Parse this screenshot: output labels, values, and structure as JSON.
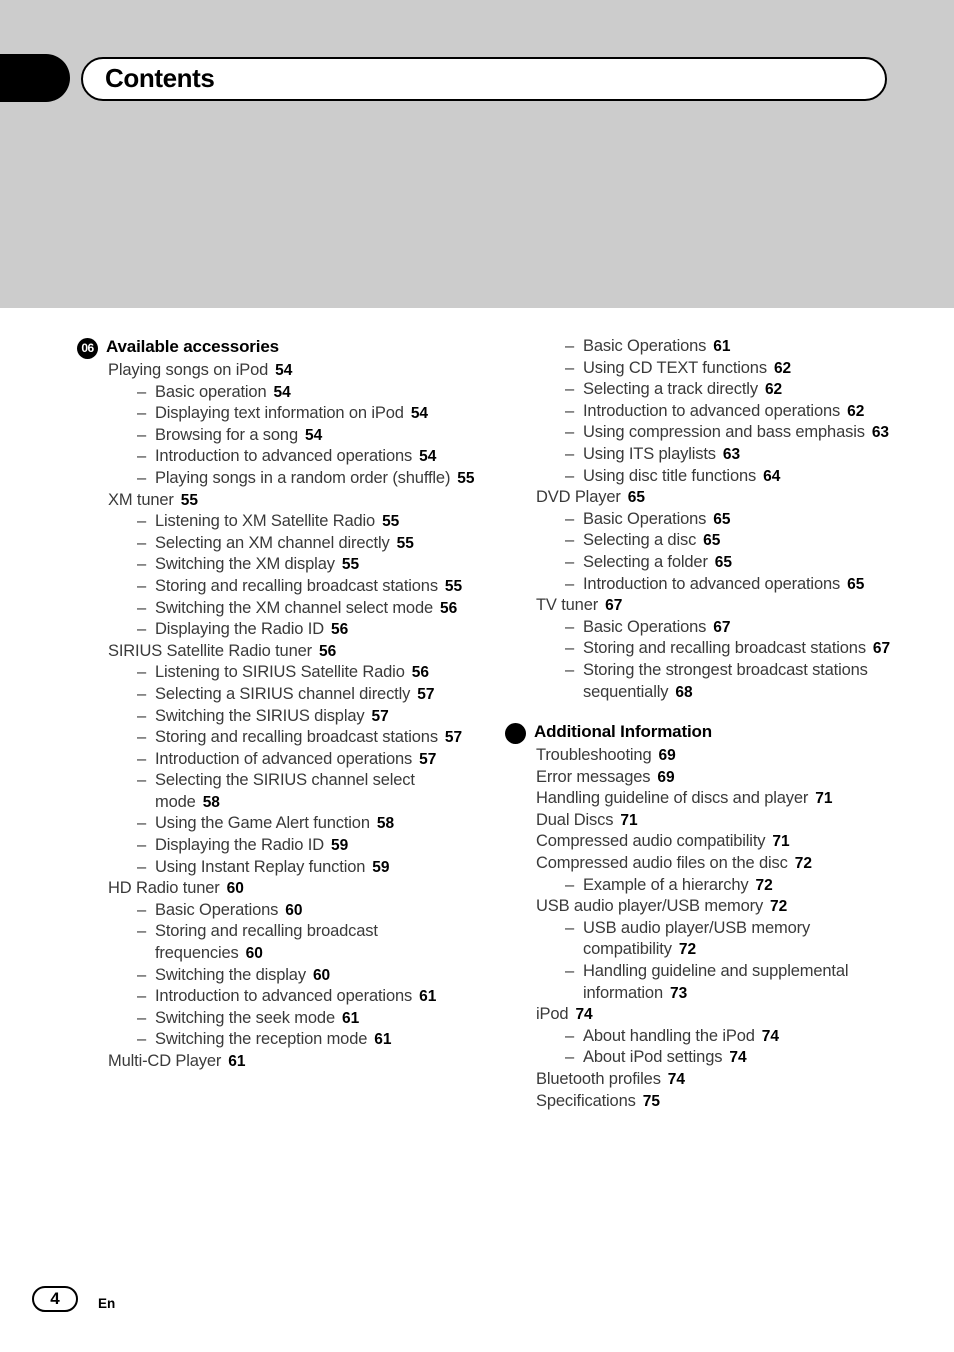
{
  "page": {
    "title": "Contents",
    "number": "4",
    "language": "En"
  },
  "columns": {
    "left": [
      {
        "badge": "06",
        "badge_type": "number",
        "heading": "Available accessories",
        "entries": [
          {
            "level": 1,
            "text": "Playing songs on iPod",
            "page": "54"
          },
          {
            "level": 2,
            "text": "Basic operation",
            "page": "54"
          },
          {
            "level": 2,
            "text": "Displaying text information on iPod",
            "page": "54"
          },
          {
            "level": 2,
            "text": "Browsing for a song",
            "page": "54"
          },
          {
            "level": 2,
            "text": "Introduction to advanced operations",
            "page": "54"
          },
          {
            "level": 2,
            "text": "Playing songs in a random order (shuffle)",
            "page": "55"
          },
          {
            "level": 1,
            "text": "XM tuner",
            "page": "55"
          },
          {
            "level": 2,
            "text": "Listening to XM Satellite Radio",
            "page": "55"
          },
          {
            "level": 2,
            "text": "Selecting an XM channel directly",
            "page": "55"
          },
          {
            "level": 2,
            "text": "Switching the XM display",
            "page": "55"
          },
          {
            "level": 2,
            "text": "Storing and recalling broadcast stations",
            "page": "55"
          },
          {
            "level": 2,
            "text": "Switching the XM channel select mode",
            "page": "56"
          },
          {
            "level": 2,
            "text": "Displaying the Radio ID",
            "page": "56"
          },
          {
            "level": 1,
            "text": "SIRIUS Satellite Radio tuner",
            "page": "56"
          },
          {
            "level": 2,
            "text": "Listening to SIRIUS Satellite Radio",
            "page": "56"
          },
          {
            "level": 2,
            "text": "Selecting a SIRIUS channel directly",
            "page": "57"
          },
          {
            "level": 2,
            "text": "Switching the SIRIUS display",
            "page": "57"
          },
          {
            "level": 2,
            "text": "Storing and recalling broadcast stations",
            "page": "57"
          },
          {
            "level": 2,
            "text": "Introduction of advanced operations",
            "page": "57"
          },
          {
            "level": 2,
            "text": "Selecting the SIRIUS channel select mode",
            "page": "58"
          },
          {
            "level": 2,
            "text": "Using the Game Alert function",
            "page": "58"
          },
          {
            "level": 2,
            "text": "Displaying the Radio ID",
            "page": "59"
          },
          {
            "level": 2,
            "text": "Using Instant Replay function",
            "page": "59"
          },
          {
            "level": 1,
            "text": "HD Radio tuner",
            "page": "60"
          },
          {
            "level": 2,
            "text": "Basic Operations",
            "page": "60"
          },
          {
            "level": 2,
            "text": "Storing and recalling broadcast frequencies",
            "page": "60"
          },
          {
            "level": 2,
            "text": "Switching the display",
            "page": "60"
          },
          {
            "level": 2,
            "text": "Introduction to advanced operations",
            "page": "61"
          },
          {
            "level": 2,
            "text": "Switching the seek mode",
            "page": "61"
          },
          {
            "level": 2,
            "text": "Switching the reception mode",
            "page": "61"
          },
          {
            "level": 1,
            "text": "Multi-CD Player",
            "page": "61"
          }
        ]
      }
    ],
    "right": [
      {
        "badge": null,
        "badge_type": "none",
        "heading": null,
        "entries": [
          {
            "level": 2,
            "text": "Basic Operations",
            "page": "61"
          },
          {
            "level": 2,
            "text": "Using CD TEXT functions",
            "page": "62"
          },
          {
            "level": 2,
            "text": "Selecting a track directly",
            "page": "62"
          },
          {
            "level": 2,
            "text": "Introduction to advanced operations",
            "page": "62"
          },
          {
            "level": 2,
            "text": "Using compression and bass emphasis",
            "page": "63"
          },
          {
            "level": 2,
            "text": "Using ITS playlists",
            "page": "63"
          },
          {
            "level": 2,
            "text": "Using disc title functions",
            "page": "64"
          },
          {
            "level": 1,
            "text": "DVD Player",
            "page": "65"
          },
          {
            "level": 2,
            "text": "Basic Operations",
            "page": "65"
          },
          {
            "level": 2,
            "text": "Selecting a disc",
            "page": "65"
          },
          {
            "level": 2,
            "text": "Selecting a folder",
            "page": "65"
          },
          {
            "level": 2,
            "text": "Introduction to advanced operations",
            "page": "65"
          },
          {
            "level": 1,
            "text": "TV tuner",
            "page": "67"
          },
          {
            "level": 2,
            "text": "Basic Operations",
            "page": "67"
          },
          {
            "level": 2,
            "text": "Storing and recalling broadcast stations",
            "page": "67"
          },
          {
            "level": 2,
            "text": "Storing the strongest broadcast stations sequentially",
            "page": "68"
          }
        ]
      },
      {
        "badge": "",
        "badge_type": "dot",
        "heading": "Additional Information",
        "entries": [
          {
            "level": 1,
            "text": "Troubleshooting",
            "page": "69"
          },
          {
            "level": 1,
            "text": "Error messages",
            "page": "69"
          },
          {
            "level": 1,
            "text": "Handling guideline of discs and player",
            "page": "71"
          },
          {
            "level": 1,
            "text": "Dual Discs",
            "page": "71"
          },
          {
            "level": 1,
            "text": "Compressed audio compatibility",
            "page": "71"
          },
          {
            "level": 1,
            "text": "Compressed audio files on the disc",
            "page": "72"
          },
          {
            "level": 2,
            "text": "Example of a hierarchy",
            "page": "72"
          },
          {
            "level": 1,
            "text": "USB audio player/USB memory",
            "page": "72"
          },
          {
            "level": 2,
            "text": "USB audio player/USB memory compatibility",
            "page": "72"
          },
          {
            "level": 2,
            "text": "Handling guideline and supplemental information",
            "page": "73"
          },
          {
            "level": 1,
            "text": "iPod",
            "page": "74"
          },
          {
            "level": 2,
            "text": "About handling the iPod",
            "page": "74"
          },
          {
            "level": 2,
            "text": "About iPod settings",
            "page": "74"
          },
          {
            "level": 1,
            "text": "Bluetooth profiles",
            "page": "74"
          },
          {
            "level": 1,
            "text": "Specifications",
            "page": "75"
          }
        ]
      }
    ]
  },
  "icons": {
    "section_badge": "section-number-badge",
    "section_dot": "section-dot-badge",
    "dash": "–"
  },
  "colors": {
    "band": "#cccccc",
    "text": "#3a3a3a",
    "accent": "#000000"
  }
}
